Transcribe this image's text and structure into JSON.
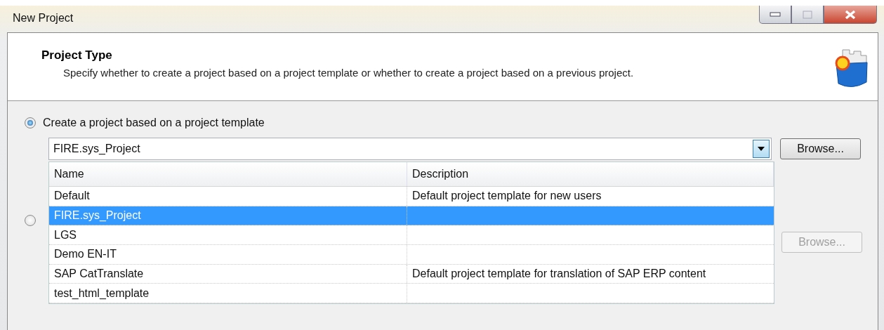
{
  "window": {
    "title": "New Project"
  },
  "header": {
    "title": "Project Type",
    "description": "Specify whether to create a project based on a project template or whether to create a project based on a previous project."
  },
  "options": [
    {
      "kind": "template",
      "label": "Create a project based on a project template",
      "selected": true,
      "combo": {
        "value": "FIRE.sys_Project"
      },
      "browse": {
        "label": "Browse...",
        "disabled": false
      }
    },
    {
      "kind": "previous",
      "selected": false,
      "browse": {
        "label": "Browse...",
        "disabled": true
      }
    }
  ],
  "dropdown": {
    "columns": [
      "Name",
      "Description"
    ],
    "rows": [
      {
        "name": "Default",
        "description": "Default project template for new users",
        "selected": false
      },
      {
        "name": "FIRE.sys_Project",
        "description": "",
        "selected": true
      },
      {
        "name": "LGS",
        "description": "",
        "selected": false
      },
      {
        "name": "Demo EN-IT",
        "description": "",
        "selected": false
      },
      {
        "name": "SAP CatTranslate",
        "description": "Default project template for translation of SAP ERP content",
        "selected": false
      },
      {
        "name": "test_html_template",
        "description": "",
        "selected": false
      }
    ]
  }
}
